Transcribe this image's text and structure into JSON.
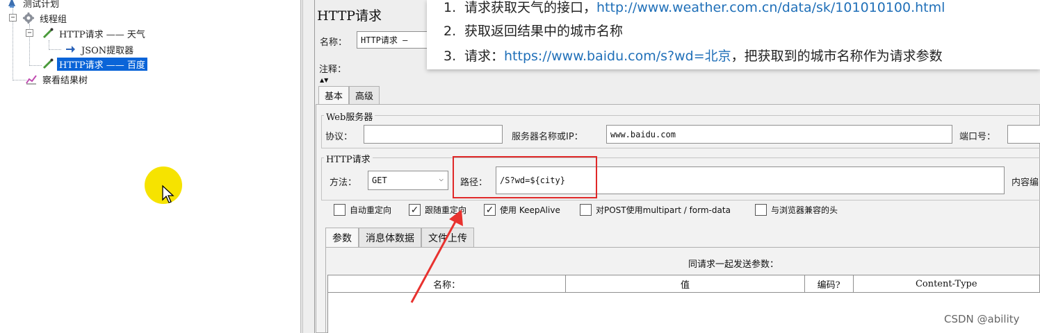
{
  "tree": {
    "test_plan": "测试计划",
    "thread_group": "线程组",
    "http_request_weather": "HTTP请求 —— 天气",
    "json_extractor": "JSON提取器",
    "http_request_baidu": "HTTP请求 —— 百度",
    "results_tree": "察看结果树"
  },
  "panel": {
    "title": "HTTP请求",
    "name_label": "名称：",
    "name_value": "HTTP请求 —",
    "comment_label": "注释："
  },
  "overlay": {
    "lines": [
      {
        "num": "1.",
        "text": "请求获取天气的接口，",
        "link": "http://www.weather.com.cn/data/sk/101010100.html",
        "tail": ""
      },
      {
        "num": "2.",
        "text": "获取返回结果中的城市名称",
        "link": "",
        "tail": ""
      },
      {
        "num": "3.",
        "text": "请求：",
        "link": "https://www.baidu.com/s?wd=北京",
        "tail": "，把获取到的城市名称作为请求参数"
      }
    ]
  },
  "tabs": {
    "basic": "基本",
    "advanced": "高级"
  },
  "web_server": {
    "title": "Web服务器",
    "protocol_label": "协议：",
    "protocol_value": "",
    "server_label": "服务器名称或IP：",
    "server_value": "www.baidu.com",
    "port_label": "端口号："
  },
  "http_request": {
    "title": "HTTP请求",
    "method_label": "方法：",
    "method_value": "GET",
    "path_label": "路径：",
    "path_value": "/S?wd=${city}",
    "content_encoding_label": "内容编"
  },
  "checkboxes": [
    {
      "label": "自动重定向",
      "checked": false
    },
    {
      "label": "跟随重定向",
      "checked": true
    },
    {
      "label": "使用 KeepAlive",
      "checked": true
    },
    {
      "label": "对POST使用multipart / form-data",
      "checked": false
    },
    {
      "label": "与浏览器兼容的头",
      "checked": false
    }
  ],
  "sub_tabs": {
    "params": "参数",
    "body": "消息体数据",
    "files": "文件上传"
  },
  "params_table": {
    "title": "同请求一起发送参数：",
    "headers": [
      "名称：",
      "值",
      "编码?",
      "Content-Type"
    ]
  },
  "watermark": "CSDN @ability",
  "colors": {
    "selection": "#0a64d8",
    "highlight_box": "#e02828",
    "arrow": "#e8322f",
    "link": "#1f6fb8",
    "cursor_halo": "#f6e300"
  }
}
